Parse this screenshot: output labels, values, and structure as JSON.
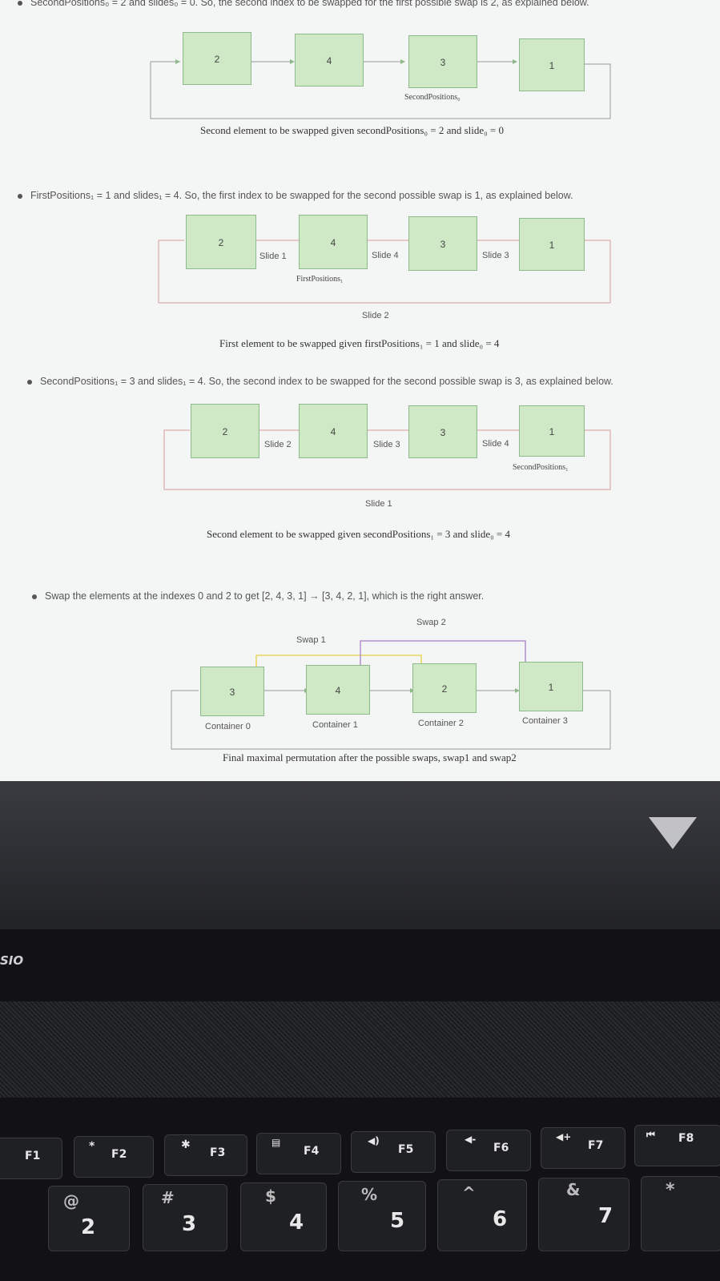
{
  "doc": {
    "line1": "SecondPositions₀ = 2 and slides₀ = 0. So, the second index to be swapped for the first possible swap is 2, as explained below.",
    "fig1": {
      "boxes": [
        "2",
        "4",
        "3",
        "1"
      ],
      "pointer": "SecondPositions₀",
      "caption": "Second element to be swapped given secondPositions₀ = 2 and slide₀ = 0"
    },
    "bullet2": "FirstPositions₁ = 1 and slides₁ = 4. So, the first index to be swapped for the second possible swap is 1, as explained below.",
    "fig2": {
      "boxes": [
        "2",
        "4",
        "3",
        "1"
      ],
      "slides": [
        "Slide 1",
        "Slide 4",
        "Slide 3"
      ],
      "bottom_slide": "Slide 2",
      "pointer": "FirstPositions₁",
      "caption": "First element to be swapped given firstPositions₁ = 1 and slide₀ = 4"
    },
    "bullet3": "SecondPositions₁ = 3 and slides₁ = 4. So, the second index to be swapped for the second possible swap is 3, as explained below.",
    "fig3": {
      "boxes": [
        "2",
        "4",
        "3",
        "1"
      ],
      "slides": [
        "Slide 2",
        "Slide 3",
        "Slide 4"
      ],
      "bottom_slide": "Slide 1",
      "pointer": "SecondPositions₁",
      "caption": "Second element to be swapped given secondPositions₁ = 3 and slide₀ = 4"
    },
    "bullet4": "Swap the elements at the indexes 0 and 2 to get [2, 4, 3, 1] → [3, 4, 2, 1], which is the right answer.",
    "fig4": {
      "boxes": [
        "3",
        "4",
        "2",
        "1"
      ],
      "containers": [
        "Container 0",
        "Container 1",
        "Container 2",
        "Container 3"
      ],
      "swaps": [
        "Swap 1",
        "Swap 2"
      ],
      "caption": "Final maximal permutation after the possible swaps, swap1 and swap2"
    }
  },
  "laptop": {
    "brand_text": "SIO",
    "fkeys": [
      "F1",
      "F2",
      "F3",
      "F4",
      "F5",
      "F6",
      "F7",
      "F8"
    ],
    "fkey_symbols": [
      "",
      "*",
      "✱",
      "▤",
      "◀)",
      "◀-",
      "◀+",
      "⏮"
    ],
    "number_keys": [
      "2",
      "3",
      "4",
      "5",
      "6",
      "7"
    ],
    "number_symbols": [
      "@",
      "#",
      "$",
      "%",
      "^",
      "&"
    ]
  },
  "colors": {
    "box_fill": "#cfe8c5",
    "box_border": "#8fb98a",
    "loop_line": "#d89a9a",
    "swap_line": "#e6d65a"
  }
}
